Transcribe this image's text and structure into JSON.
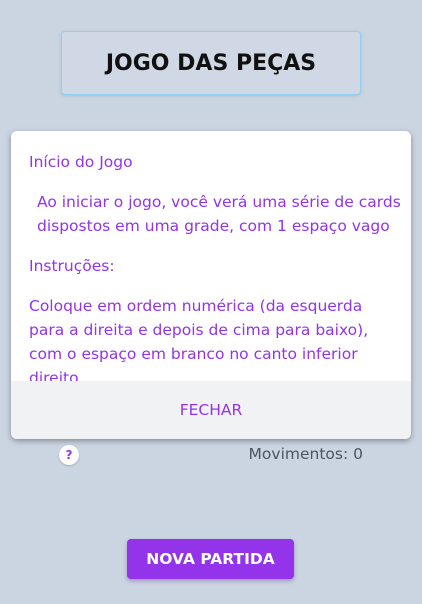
{
  "header": {
    "title": "JOGO DAS PEÇAS"
  },
  "modal": {
    "heading1": "Início do Jogo",
    "paragraph1": "Ao iniciar o jogo, você verá uma série de cards dispostos em uma grade, com 1 espaço vago",
    "heading2": "Instruções:",
    "paragraph2": "Coloque em ordem numérica (da esquerda para a direita e depois de cima para baixo), com o espaço em branco no canto inferior direito.",
    "close_label": "FECHAR"
  },
  "status": {
    "help_icon": "question-mark-icon",
    "help_glyph": "?",
    "moves_text": "Movimentos: 0"
  },
  "actions": {
    "new_game_label": "NOVA PARTIDA"
  },
  "colors": {
    "accent": "#9333ea",
    "background": "#cbd5e1"
  }
}
